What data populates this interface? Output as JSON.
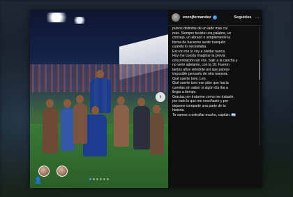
{
  "post": {
    "username": "enzojfernandez",
    "follow_label": "Seguidos",
    "more_label": "···",
    "caption_lines": [
      "pulsos distintos de un lado mas cal",
      "más. Siempre tuviste una palabra, un",
      "consejo, un abrazo o simplemente la",
      "forma de hacerme sentir tranquilo",
      "cuando lo necesitaba.",
      "Eso no me lo voy a olvidar nunca.",
      "Hoy me cuesta imaginar la previa",
      "concentración sin vos. Salir a la cancha y",
      "no verte adelante, con la 10. Fueron",
      "tantos años viéndote así que parece",
      "imposible pensarlo de otra manera.",
      "Qué suerte tuve, Leo.",
      "Qué suerte tuvo ese pibe que hacía",
      "cuentas sin saber si algún día iba a",
      "llegar a tiempo.",
      "Gracias por tratarme como me trataste,",
      "por todo lo que me enseñaste y por",
      "dejarme compartir una parte de tu",
      "historia.",
      "Te vamos a extrañar mucho, capitán. 🇦🇷"
    ]
  },
  "photo": {
    "next_arrow": "›",
    "slide_count": 6,
    "active_slide": 0,
    "tag_icon": "user-tag-icon",
    "user_glyph": "👤"
  },
  "colors": {
    "verified": "#3897f0",
    "active_dot": "#3b9cff",
    "argentina_blue": "#1c3d8f",
    "post_bg": "#0f0f0f"
  }
}
